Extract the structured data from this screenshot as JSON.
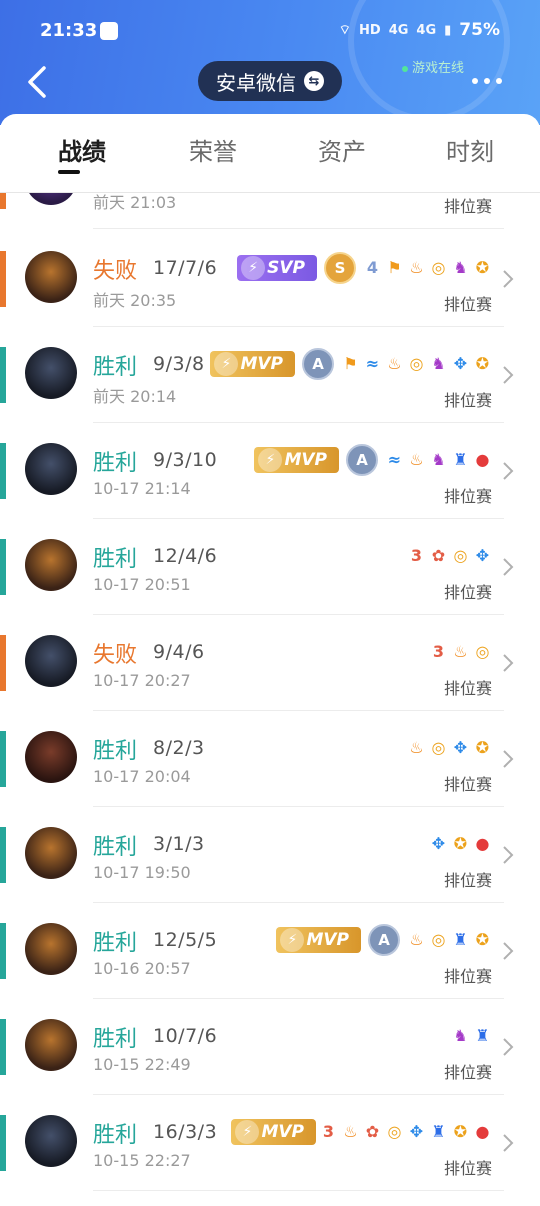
{
  "status_bar": {
    "time": "21:33",
    "hd": "HD",
    "net1": "4G",
    "net2": "4G",
    "battery": "75%"
  },
  "header": {
    "title": "安卓微信",
    "switch_symbol": "⇆",
    "online_text": "游戏在线"
  },
  "tabs": [
    {
      "label": "战绩"
    },
    {
      "label": "荣誉"
    },
    {
      "label": "资产"
    },
    {
      "label": "时刻"
    }
  ],
  "colors": {
    "win": "#26a69a",
    "loss": "#e8772e",
    "header": "#4a86ef"
  },
  "matches": [
    {
      "result": "",
      "kda": "",
      "datetime": "前天 21:03",
      "mode": "排位赛",
      "type": "partial",
      "badge": null,
      "grade": null,
      "icons": []
    },
    {
      "result": "失败",
      "kda": "17/7/6",
      "datetime": "前天 20:35",
      "mode": "排位赛",
      "type": "loss",
      "badge": "SVP",
      "grade": "S",
      "icons": [
        "four-icon",
        "flag-icon",
        "flame-icon",
        "coins-icon",
        "demon-icon",
        "gold-icon"
      ]
    },
    {
      "result": "胜利",
      "kda": "9/3/8",
      "datetime": "前天 20:14",
      "mode": "排位赛",
      "type": "win",
      "badge": "MVP",
      "grade": "A",
      "icons": [
        "flag-icon",
        "wave-icon",
        "flame-icon",
        "coins-icon",
        "demon-icon",
        "wings-icon",
        "gold-icon"
      ]
    },
    {
      "result": "胜利",
      "kda": "9/3/10",
      "datetime": "10-17 21:14",
      "mode": "排位赛",
      "type": "win",
      "badge": "MVP",
      "grade": "A",
      "icons": [
        "wave-icon",
        "flame-icon",
        "demon-icon",
        "tower-icon",
        "blood-icon"
      ]
    },
    {
      "result": "胜利",
      "kda": "12/4/6",
      "datetime": "10-17 20:51",
      "mode": "排位赛",
      "type": "win",
      "badge": null,
      "grade": null,
      "icons": [
        "three-icon",
        "lotus-icon",
        "coins-icon",
        "wings-icon"
      ]
    },
    {
      "result": "失败",
      "kda": "9/4/6",
      "datetime": "10-17 20:27",
      "mode": "排位赛",
      "type": "loss",
      "badge": null,
      "grade": null,
      "icons": [
        "three-icon",
        "flame-icon",
        "coins-icon"
      ]
    },
    {
      "result": "胜利",
      "kda": "8/2/3",
      "datetime": "10-17 20:04",
      "mode": "排位赛",
      "type": "win",
      "badge": null,
      "grade": null,
      "icons": [
        "flame-icon",
        "coins-icon",
        "wings-icon",
        "gold-icon"
      ]
    },
    {
      "result": "胜利",
      "kda": "3/1/3",
      "datetime": "10-17 19:50",
      "mode": "排位赛",
      "type": "win",
      "badge": null,
      "grade": null,
      "icons": [
        "wings-icon",
        "gold-icon",
        "blood-icon"
      ]
    },
    {
      "result": "胜利",
      "kda": "12/5/5",
      "datetime": "10-16 20:57",
      "mode": "排位赛",
      "type": "win",
      "badge": "MVP",
      "grade": "A",
      "icons": [
        "flame-icon",
        "coins-icon",
        "tower-icon",
        "gold-icon"
      ]
    },
    {
      "result": "胜利",
      "kda": "10/7/6",
      "datetime": "10-15 22:49",
      "mode": "排位赛",
      "type": "win",
      "badge": null,
      "grade": null,
      "icons": [
        "demon-icon",
        "tower-icon"
      ]
    },
    {
      "result": "胜利",
      "kda": "16/3/3",
      "datetime": "10-15 22:27",
      "mode": "排位赛",
      "type": "win",
      "badge": "MVP",
      "grade": null,
      "icons": [
        "three-icon",
        "flame-icon",
        "lotus-icon",
        "coins-icon",
        "wings-icon",
        "tower-icon",
        "gold-icon",
        "blood-icon"
      ]
    }
  ]
}
